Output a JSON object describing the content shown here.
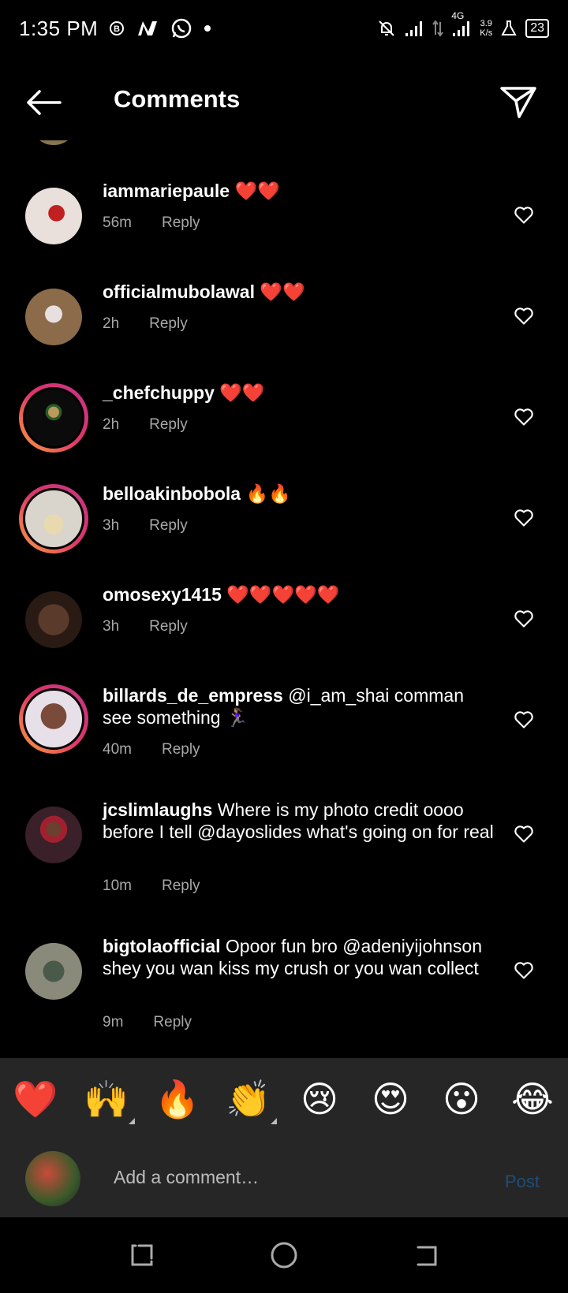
{
  "status": {
    "time": "1:35 PM",
    "net_type": "4G",
    "net_speed_value": "3.9",
    "net_speed_unit": "K/s",
    "battery": "23"
  },
  "header": {
    "title": "Comments"
  },
  "comments": [
    {
      "username": "iammariepaule",
      "text": "❤️❤️",
      "time": "56m",
      "reply": "Reply",
      "avatar_color": "#e9e0dc",
      "ring": false
    },
    {
      "username": "officialmubolawal",
      "text": "❤️❤️",
      "time": "2h",
      "reply": "Reply",
      "avatar_color": "#8b6b4a",
      "ring": false
    },
    {
      "username": "_chefchuppy",
      "text": "❤️❤️",
      "time": "2h",
      "reply": "Reply",
      "avatar_color": "#0b0b0b",
      "ring": true
    },
    {
      "username": "belloakinbobola",
      "text": "🔥🔥",
      "time": "3h",
      "reply": "Reply",
      "avatar_color": "#d9d4cc",
      "ring": true
    },
    {
      "username": "omosexy1415",
      "text": "❤️❤️❤️❤️❤️",
      "time": "3h",
      "reply": "Reply",
      "avatar_color": "#5a3a2a",
      "ring": false
    },
    {
      "username": "billards_de_empress",
      "text": "@i_am_shai comman see something 🏃🏽‍♀️",
      "time": "40m",
      "reply": "Reply",
      "avatar_color": "#7a4a3a",
      "ring": true
    },
    {
      "username": "jcslimlaughs",
      "text": "Where is my photo credit oooo before I tell @dayoslides what's going on for real",
      "time": "10m",
      "reply": "Reply",
      "avatar_color": "#3a2028",
      "ring": false
    },
    {
      "username": "bigtolaofficial",
      "text": "Opoor fun bro @adeniyijohnson shey you wan kiss my crush or you wan collect",
      "time": "9m",
      "reply": "Reply",
      "avatar_color": "#8a8a7a",
      "ring": false
    }
  ],
  "emoji_bar": [
    "❤️",
    "🙌",
    "🔥",
    "👏",
    "😢",
    "😍",
    "😮",
    "😂"
  ],
  "comment_input": {
    "placeholder": "Add a comment…",
    "post_label": "Post"
  },
  "colors": {
    "background": "#000000",
    "panel": "#262626",
    "meta": "#a8a8a8",
    "post_disabled": "#1f4e79",
    "ring_start": "#f9a13a",
    "ring_end": "#c13584"
  }
}
